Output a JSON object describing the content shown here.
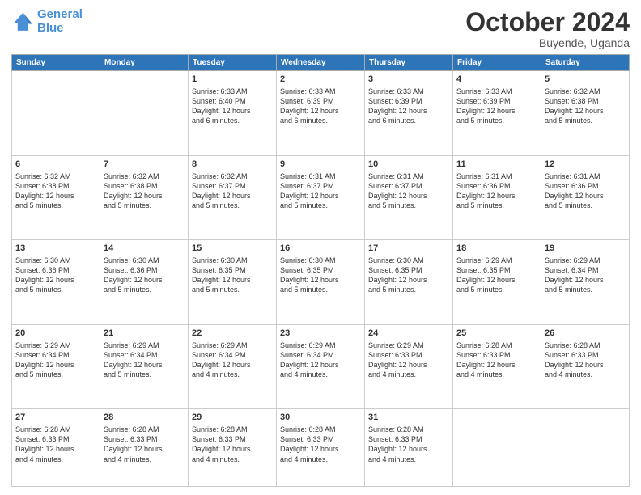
{
  "header": {
    "logo_line1": "General",
    "logo_line2": "Blue",
    "main_title": "October 2024",
    "subtitle": "Buyende, Uganda"
  },
  "days_of_week": [
    "Sunday",
    "Monday",
    "Tuesday",
    "Wednesday",
    "Thursday",
    "Friday",
    "Saturday"
  ],
  "weeks": [
    [
      {
        "num": "",
        "info": ""
      },
      {
        "num": "",
        "info": ""
      },
      {
        "num": "1",
        "info": "Sunrise: 6:33 AM\nSunset: 6:40 PM\nDaylight: 12 hours\nand 6 minutes."
      },
      {
        "num": "2",
        "info": "Sunrise: 6:33 AM\nSunset: 6:39 PM\nDaylight: 12 hours\nand 6 minutes."
      },
      {
        "num": "3",
        "info": "Sunrise: 6:33 AM\nSunset: 6:39 PM\nDaylight: 12 hours\nand 6 minutes."
      },
      {
        "num": "4",
        "info": "Sunrise: 6:33 AM\nSunset: 6:39 PM\nDaylight: 12 hours\nand 5 minutes."
      },
      {
        "num": "5",
        "info": "Sunrise: 6:32 AM\nSunset: 6:38 PM\nDaylight: 12 hours\nand 5 minutes."
      }
    ],
    [
      {
        "num": "6",
        "info": "Sunrise: 6:32 AM\nSunset: 6:38 PM\nDaylight: 12 hours\nand 5 minutes."
      },
      {
        "num": "7",
        "info": "Sunrise: 6:32 AM\nSunset: 6:38 PM\nDaylight: 12 hours\nand 5 minutes."
      },
      {
        "num": "8",
        "info": "Sunrise: 6:32 AM\nSunset: 6:37 PM\nDaylight: 12 hours\nand 5 minutes."
      },
      {
        "num": "9",
        "info": "Sunrise: 6:31 AM\nSunset: 6:37 PM\nDaylight: 12 hours\nand 5 minutes."
      },
      {
        "num": "10",
        "info": "Sunrise: 6:31 AM\nSunset: 6:37 PM\nDaylight: 12 hours\nand 5 minutes."
      },
      {
        "num": "11",
        "info": "Sunrise: 6:31 AM\nSunset: 6:36 PM\nDaylight: 12 hours\nand 5 minutes."
      },
      {
        "num": "12",
        "info": "Sunrise: 6:31 AM\nSunset: 6:36 PM\nDaylight: 12 hours\nand 5 minutes."
      }
    ],
    [
      {
        "num": "13",
        "info": "Sunrise: 6:30 AM\nSunset: 6:36 PM\nDaylight: 12 hours\nand 5 minutes."
      },
      {
        "num": "14",
        "info": "Sunrise: 6:30 AM\nSunset: 6:36 PM\nDaylight: 12 hours\nand 5 minutes."
      },
      {
        "num": "15",
        "info": "Sunrise: 6:30 AM\nSunset: 6:35 PM\nDaylight: 12 hours\nand 5 minutes."
      },
      {
        "num": "16",
        "info": "Sunrise: 6:30 AM\nSunset: 6:35 PM\nDaylight: 12 hours\nand 5 minutes."
      },
      {
        "num": "17",
        "info": "Sunrise: 6:30 AM\nSunset: 6:35 PM\nDaylight: 12 hours\nand 5 minutes."
      },
      {
        "num": "18",
        "info": "Sunrise: 6:29 AM\nSunset: 6:35 PM\nDaylight: 12 hours\nand 5 minutes."
      },
      {
        "num": "19",
        "info": "Sunrise: 6:29 AM\nSunset: 6:34 PM\nDaylight: 12 hours\nand 5 minutes."
      }
    ],
    [
      {
        "num": "20",
        "info": "Sunrise: 6:29 AM\nSunset: 6:34 PM\nDaylight: 12 hours\nand 5 minutes."
      },
      {
        "num": "21",
        "info": "Sunrise: 6:29 AM\nSunset: 6:34 PM\nDaylight: 12 hours\nand 5 minutes."
      },
      {
        "num": "22",
        "info": "Sunrise: 6:29 AM\nSunset: 6:34 PM\nDaylight: 12 hours\nand 4 minutes."
      },
      {
        "num": "23",
        "info": "Sunrise: 6:29 AM\nSunset: 6:34 PM\nDaylight: 12 hours\nand 4 minutes."
      },
      {
        "num": "24",
        "info": "Sunrise: 6:29 AM\nSunset: 6:33 PM\nDaylight: 12 hours\nand 4 minutes."
      },
      {
        "num": "25",
        "info": "Sunrise: 6:28 AM\nSunset: 6:33 PM\nDaylight: 12 hours\nand 4 minutes."
      },
      {
        "num": "26",
        "info": "Sunrise: 6:28 AM\nSunset: 6:33 PM\nDaylight: 12 hours\nand 4 minutes."
      }
    ],
    [
      {
        "num": "27",
        "info": "Sunrise: 6:28 AM\nSunset: 6:33 PM\nDaylight: 12 hours\nand 4 minutes."
      },
      {
        "num": "28",
        "info": "Sunrise: 6:28 AM\nSunset: 6:33 PM\nDaylight: 12 hours\nand 4 minutes."
      },
      {
        "num": "29",
        "info": "Sunrise: 6:28 AM\nSunset: 6:33 PM\nDaylight: 12 hours\nand 4 minutes."
      },
      {
        "num": "30",
        "info": "Sunrise: 6:28 AM\nSunset: 6:33 PM\nDaylight: 12 hours\nand 4 minutes."
      },
      {
        "num": "31",
        "info": "Sunrise: 6:28 AM\nSunset: 6:33 PM\nDaylight: 12 hours\nand 4 minutes."
      },
      {
        "num": "",
        "info": ""
      },
      {
        "num": "",
        "info": ""
      }
    ]
  ]
}
